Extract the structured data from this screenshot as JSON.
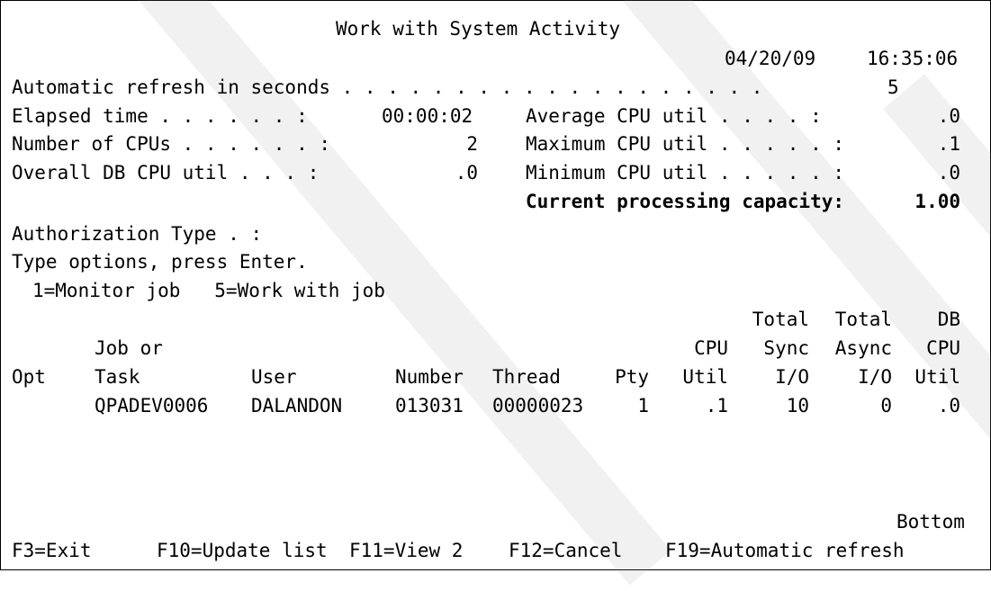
{
  "screen_title": "Work with System Activity",
  "date": "04/20/09",
  "time": "16:35:06",
  "refresh": {
    "label": "Automatic refresh in seconds . . . . . . . . . . . . . . . . . . .",
    "value": "5"
  },
  "stats": {
    "elapsed_label": "Elapsed time . . . . . . :",
    "elapsed_value": "00:00:02",
    "cpus_label": "Number of CPUs . . . . . . :",
    "cpus_value": "2",
    "db_cpu_label": "Overall DB CPU util . . . :",
    "db_cpu_value": ".0",
    "avg_cpu_label": "Average CPU util . . . . :",
    "avg_cpu_value": ".0",
    "max_cpu_label": "Maximum CPU util . . . . . :",
    "max_cpu_value": ".1",
    "min_cpu_label": "Minimum CPU util . . . . . :",
    "min_cpu_value": ".0",
    "capacity_label": "Current processing capacity:",
    "capacity_value": "1.00"
  },
  "auth_type_label": "Authorization Type . :",
  "instructions": "Type options, press Enter.",
  "options": "1=Monitor job   5=Work with job",
  "columns": {
    "opt": "Opt",
    "job_top": "Job or",
    "job": "Task",
    "user": "User",
    "number": "Number",
    "thread": "Thread",
    "pty": "Pty",
    "cpu_top": "CPU",
    "cpu": "Util",
    "sync_top1": "Total",
    "sync_top2": "Sync",
    "sync": "I/O",
    "async_top1": "Total",
    "async_top2": "Async",
    "async": "I/O",
    "db_top1": "DB",
    "db_top2": "CPU",
    "db": "Util"
  },
  "rows": [
    {
      "opt": "",
      "job": "QPADEV0006",
      "user": "DALANDON",
      "number": "013031",
      "thread": "00000023",
      "pty": "1",
      "cpu": ".1",
      "sync": "10",
      "async": "0",
      "db": ".0"
    }
  ],
  "bottom_label": "Bottom",
  "function_keys": [
    "F3=Exit",
    "F10=Update list",
    "F11=View 2",
    "F12=Cancel",
    "F19=Automatic refresh"
  ]
}
